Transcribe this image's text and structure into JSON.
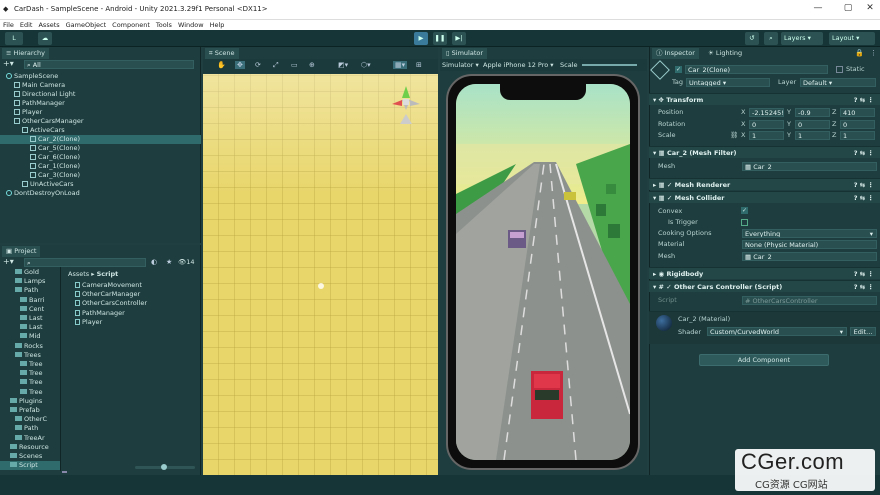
{
  "window": {
    "title": "CarDash - SampleScene - Android - Unity 2021.3.29f1 Personal <DX11>",
    "min": "—",
    "max": "▢",
    "close": "✕"
  },
  "menu": [
    "File",
    "Edit",
    "Assets",
    "GameObject",
    "Component",
    "Tools",
    "Window",
    "Help"
  ],
  "toolbar": {
    "account": "L",
    "layers": "Layers",
    "layout": "Layout"
  },
  "hierarchy": {
    "tab": "Hierarchy",
    "search_placeholder": "All",
    "items": [
      {
        "label": "SampleScene",
        "level": 0,
        "kind": "scene"
      },
      {
        "label": "Main Camera",
        "level": 1,
        "kind": "obj"
      },
      {
        "label": "Directional Light",
        "level": 1,
        "kind": "obj"
      },
      {
        "label": "PathManager",
        "level": 1,
        "kind": "obj"
      },
      {
        "label": "Player",
        "level": 1,
        "kind": "obj"
      },
      {
        "label": "OtherCarsManager",
        "level": 1,
        "kind": "obj"
      },
      {
        "label": "ActiveCars",
        "level": 2,
        "kind": "obj"
      },
      {
        "label": "Car_2(Clone)",
        "level": 3,
        "kind": "obj",
        "selected": true
      },
      {
        "label": "Car_5(Clone)",
        "level": 3,
        "kind": "obj"
      },
      {
        "label": "Car_6(Clone)",
        "level": 3,
        "kind": "obj"
      },
      {
        "label": "Car_1(Clone)",
        "level": 3,
        "kind": "obj"
      },
      {
        "label": "Car_3(Clone)",
        "level": 3,
        "kind": "obj"
      },
      {
        "label": "UnActiveCars",
        "level": 2,
        "kind": "obj"
      },
      {
        "label": "DontDestroyOnLoad",
        "level": 0,
        "kind": "scene"
      }
    ]
  },
  "project": {
    "tab": "Project",
    "count": "14",
    "breadcrumb_root": "Assets",
    "breadcrumb_leaf": "Script",
    "tree": [
      "Gold",
      "Lamps",
      "Path",
      "Barri",
      "Cent",
      "Last",
      "Last",
      "Mid",
      "Rocks",
      "Trees",
      "Tree",
      "Tree",
      "Tree",
      "Tree",
      "Plugins",
      "Prefab",
      "OtherC",
      "Path",
      "TreeAr",
      "Resource",
      "Scenes",
      "Script"
    ],
    "files": [
      "CameraMovement",
      "OtherCarManager",
      "OtherCarsController",
      "PathManager",
      "Player"
    ]
  },
  "scene": {
    "tab": "Scene"
  },
  "simulator": {
    "tab": "Simulator",
    "mode": "Simulator",
    "device": "Apple iPhone 12 Pro",
    "scale_label": "Scale"
  },
  "inspector": {
    "tab": "Inspector",
    "tab2": "Lighting",
    "object_name": "Car_2(Clone)",
    "static_label": "Static",
    "tag_label": "Tag",
    "tag_value": "Untagged",
    "layer_label": "Layer",
    "layer_value": "Default",
    "transform": {
      "title": "Transform",
      "position_label": "Position",
      "rotation_label": "Rotation",
      "scale_label": "Scale",
      "pos": {
        "x": "-2.15245!",
        "y": "-0.9",
        "z": "410"
      },
      "rot": {
        "x": "0",
        "y": "0",
        "z": "0"
      },
      "scl": {
        "x": "1",
        "y": "1",
        "z": "1"
      }
    },
    "mesh_filter": {
      "title": "Car_2 (Mesh Filter)",
      "mesh_label": "Mesh",
      "mesh_value": "Car_2"
    },
    "mesh_renderer": {
      "title": "Mesh Renderer"
    },
    "mesh_collider": {
      "title": "Mesh Collider",
      "convex": "Convex",
      "trigger": "Is Trigger",
      "cooking": "Cooking Options",
      "cooking_value": "Everything",
      "material": "Material",
      "material_value": "None (Physic Material)",
      "mesh": "Mesh",
      "mesh_value": "Car_2"
    },
    "rigidbody": {
      "title": "Rigidbody"
    },
    "script_comp": {
      "title": "Other Cars Controller (Script)",
      "script_label": "Script",
      "script_value": "OtherCarsController"
    },
    "material": {
      "name": "Car_2 (Material)",
      "shader_label": "Shader",
      "shader_value": "Custom/CurvedWorld",
      "edit": "Edit..."
    },
    "add_component": "Add Component"
  },
  "watermark": {
    "big": "CGer.com",
    "small": "CG资源 CG网站"
  },
  "colors": {
    "teal_bg": "#1e3d3e",
    "scene_yellow": "#e8d66a",
    "road": "#8a8f8c",
    "accent": "#2f6a6c"
  }
}
